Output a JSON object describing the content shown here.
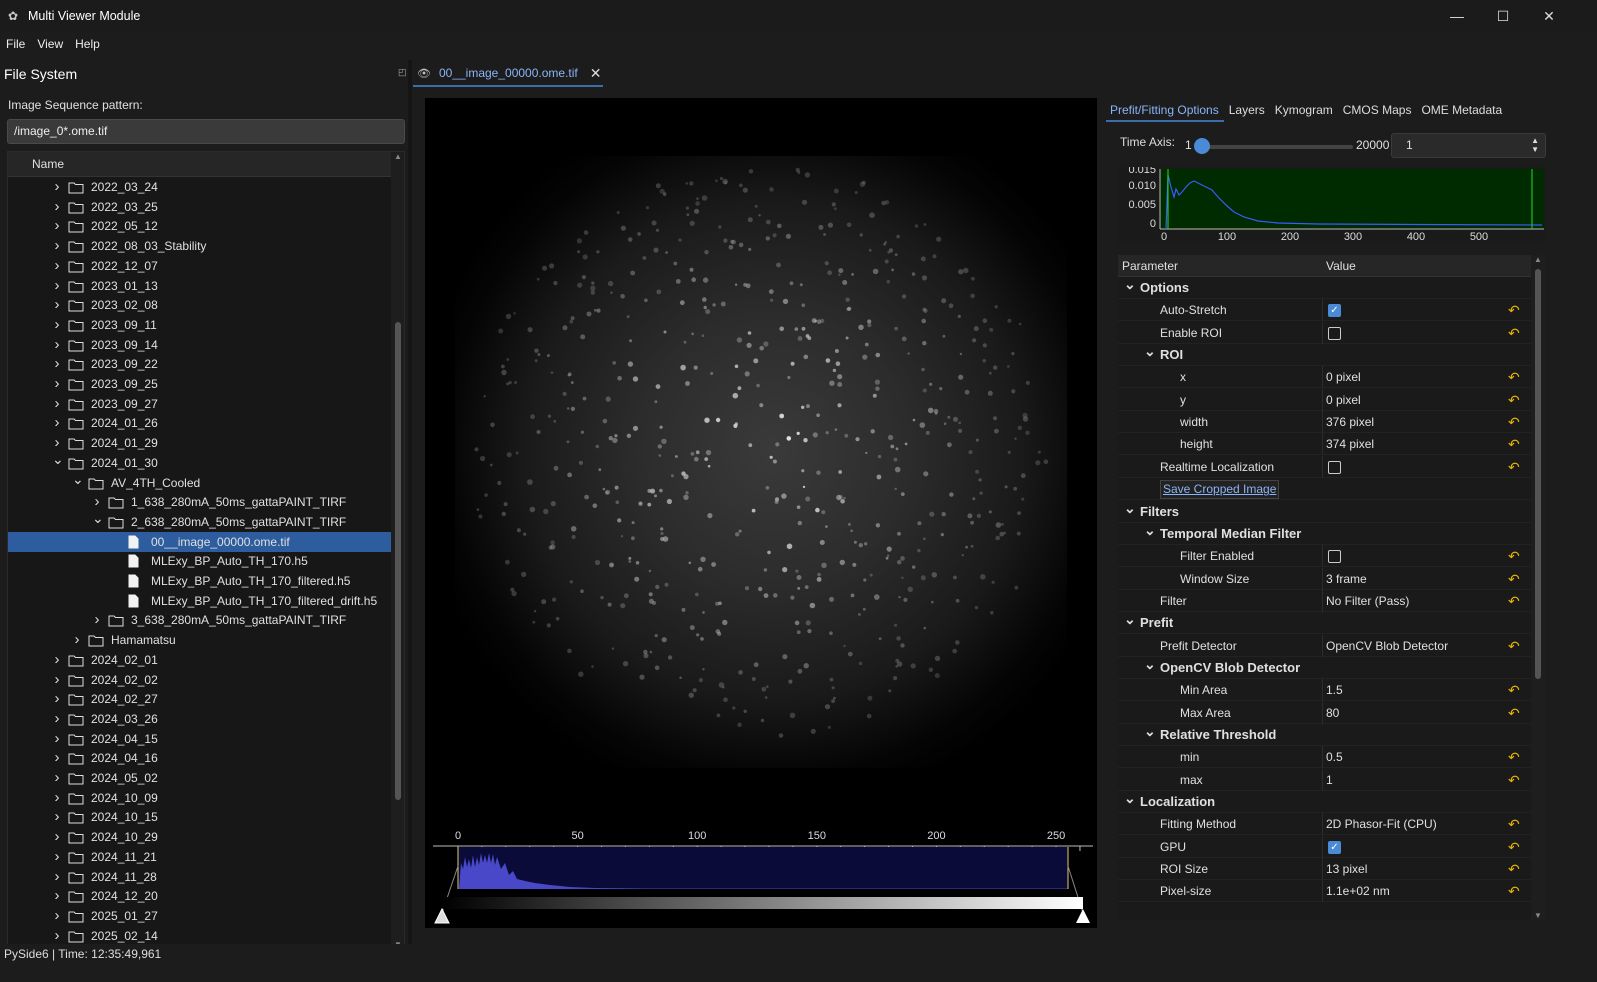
{
  "window": {
    "title": "Multi Viewer Module",
    "icons": [
      "app-icon",
      "minimize-icon",
      "maximize-icon",
      "close-icon"
    ]
  },
  "menu": [
    "File",
    "View",
    "Help"
  ],
  "filesystem": {
    "title": "File System",
    "pattern_label": "Image Sequence pattern:",
    "pattern_value": "/image_0*.ome.tif",
    "column": "Name",
    "rows": [
      {
        "label": "2022_03_24",
        "depth": 2,
        "type": "folder",
        "state": "collapsed"
      },
      {
        "label": "2022_03_25",
        "depth": 2,
        "type": "folder",
        "state": "collapsed"
      },
      {
        "label": "2022_05_12",
        "depth": 2,
        "type": "folder",
        "state": "collapsed"
      },
      {
        "label": "2022_08_03_Stability",
        "depth": 2,
        "type": "folder",
        "state": "collapsed"
      },
      {
        "label": "2022_12_07",
        "depth": 2,
        "type": "folder",
        "state": "collapsed"
      },
      {
        "label": "2023_01_13",
        "depth": 2,
        "type": "folder",
        "state": "collapsed"
      },
      {
        "label": "2023_02_08",
        "depth": 2,
        "type": "folder",
        "state": "collapsed"
      },
      {
        "label": "2023_09_11",
        "depth": 2,
        "type": "folder",
        "state": "collapsed"
      },
      {
        "label": "2023_09_14",
        "depth": 2,
        "type": "folder",
        "state": "collapsed"
      },
      {
        "label": "2023_09_22",
        "depth": 2,
        "type": "folder",
        "state": "collapsed"
      },
      {
        "label": "2023_09_25",
        "depth": 2,
        "type": "folder",
        "state": "collapsed"
      },
      {
        "label": "2023_09_27",
        "depth": 2,
        "type": "folder",
        "state": "collapsed"
      },
      {
        "label": "2024_01_26",
        "depth": 2,
        "type": "folder",
        "state": "collapsed"
      },
      {
        "label": "2024_01_29",
        "depth": 2,
        "type": "folder",
        "state": "collapsed"
      },
      {
        "label": "2024_01_30",
        "depth": 2,
        "type": "folder",
        "state": "expanded"
      },
      {
        "label": "AV_4TH_Cooled",
        "depth": 3,
        "type": "folder",
        "state": "expanded"
      },
      {
        "label": "1_638_280mA_50ms_gattaPAINT_TIRF",
        "depth": 4,
        "type": "folder",
        "state": "collapsed"
      },
      {
        "label": "2_638_280mA_50ms_gattaPAINT_TIRF",
        "depth": 4,
        "type": "folder",
        "state": "expanded"
      },
      {
        "label": "00__image_00000.ome.tif",
        "depth": 5,
        "type": "file",
        "state": "selected"
      },
      {
        "label": "MLExy_BP_Auto_TH_170.h5",
        "depth": 5,
        "type": "file",
        "state": ""
      },
      {
        "label": "MLExy_BP_Auto_TH_170_filtered.h5",
        "depth": 5,
        "type": "file",
        "state": ""
      },
      {
        "label": "MLExy_BP_Auto_TH_170_filtered_drift.h5",
        "depth": 5,
        "type": "file",
        "state": ""
      },
      {
        "label": "3_638_280mA_50ms_gattaPAINT_TIRF",
        "depth": 4,
        "type": "folder",
        "state": "collapsed"
      },
      {
        "label": "Hamamatsu",
        "depth": 3,
        "type": "folder",
        "state": "collapsed"
      },
      {
        "label": "2024_02_01",
        "depth": 2,
        "type": "folder",
        "state": "collapsed"
      },
      {
        "label": "2024_02_02",
        "depth": 2,
        "type": "folder",
        "state": "collapsed"
      },
      {
        "label": "2024_02_27",
        "depth": 2,
        "type": "folder",
        "state": "collapsed"
      },
      {
        "label": "2024_03_26",
        "depth": 2,
        "type": "folder",
        "state": "collapsed"
      },
      {
        "label": "2024_04_15",
        "depth": 2,
        "type": "folder",
        "state": "collapsed"
      },
      {
        "label": "2024_04_16",
        "depth": 2,
        "type": "folder",
        "state": "collapsed"
      },
      {
        "label": "2024_05_02",
        "depth": 2,
        "type": "folder",
        "state": "collapsed"
      },
      {
        "label": "2024_10_09",
        "depth": 2,
        "type": "folder",
        "state": "collapsed"
      },
      {
        "label": "2024_10_15",
        "depth": 2,
        "type": "folder",
        "state": "collapsed"
      },
      {
        "label": "2024_10_29",
        "depth": 2,
        "type": "folder",
        "state": "collapsed"
      },
      {
        "label": "2024_11_21",
        "depth": 2,
        "type": "folder",
        "state": "collapsed"
      },
      {
        "label": "2024_11_28",
        "depth": 2,
        "type": "folder",
        "state": "collapsed"
      },
      {
        "label": "2024_12_20",
        "depth": 2,
        "type": "folder",
        "state": "collapsed"
      },
      {
        "label": "2025_01_27",
        "depth": 2,
        "type": "folder",
        "state": "collapsed"
      },
      {
        "label": "2025_02_14",
        "depth": 2,
        "type": "folder",
        "state": "collapsed"
      }
    ]
  },
  "tab": {
    "label": "00__image_00000.ome.tif"
  },
  "histogram": {
    "ticks": [
      "0",
      "50",
      "100",
      "150",
      "200",
      "250"
    ]
  },
  "right_tabs": [
    "Prefit/Fitting Options",
    "Layers",
    "Kymogram",
    "CMOS Maps",
    "OME Metadata"
  ],
  "time_axis": {
    "label": "Time Axis:",
    "min": "1",
    "max": "20000",
    "value": "1"
  },
  "mini_chart": {
    "yticks": [
      "0.015",
      "0.010",
      "0.005",
      "0"
    ],
    "xticks": [
      "0",
      "100",
      "200",
      "300",
      "400",
      "500"
    ]
  },
  "params": {
    "col_param": "Parameter",
    "col_value": "Value",
    "rows": [
      {
        "name": "Options",
        "level": 0,
        "kind": "group"
      },
      {
        "name": "Auto-Stretch",
        "level": 1,
        "kind": "check",
        "checked": true,
        "reset": true
      },
      {
        "name": "Enable ROI",
        "level": 1,
        "kind": "check",
        "checked": false,
        "reset": true
      },
      {
        "name": "ROI",
        "level": 1,
        "kind": "group"
      },
      {
        "name": "x",
        "level": 2,
        "kind": "value",
        "value": "0 pixel",
        "reset": true
      },
      {
        "name": "y",
        "level": 2,
        "kind": "value",
        "value": "0 pixel",
        "reset": true
      },
      {
        "name": "width",
        "level": 2,
        "kind": "value",
        "value": "376 pixel",
        "reset": true
      },
      {
        "name": "height",
        "level": 2,
        "kind": "value",
        "value": "374 pixel",
        "reset": true
      },
      {
        "name": "Realtime Localization",
        "level": 1,
        "kind": "check",
        "checked": false,
        "reset": true
      },
      {
        "name": "Save Cropped Image",
        "level": 1,
        "kind": "button"
      },
      {
        "name": "Filters",
        "level": 0,
        "kind": "group"
      },
      {
        "name": "Temporal Median Filter",
        "level": 1,
        "kind": "group"
      },
      {
        "name": "Filter Enabled",
        "level": 2,
        "kind": "check",
        "checked": false,
        "reset": true
      },
      {
        "name": "Window Size",
        "level": 2,
        "kind": "value",
        "value": "3 frame",
        "reset": true
      },
      {
        "name": "Filter",
        "level": 1,
        "kind": "value",
        "value": "No Filter (Pass)",
        "reset": true
      },
      {
        "name": "Prefit",
        "level": 0,
        "kind": "group"
      },
      {
        "name": "Prefit Detector",
        "level": 1,
        "kind": "value",
        "value": "OpenCV Blob Detector",
        "reset": true
      },
      {
        "name": "OpenCV Blob Detector",
        "level": 1,
        "kind": "group"
      },
      {
        "name": "Min Area",
        "level": 2,
        "kind": "value",
        "value": "1.5",
        "reset": true
      },
      {
        "name": "Max Area",
        "level": 2,
        "kind": "value",
        "value": "80",
        "reset": true
      },
      {
        "name": "Relative Threshold",
        "level": 1,
        "kind": "group"
      },
      {
        "name": "min",
        "level": 2,
        "kind": "value",
        "value": "0.5",
        "reset": true
      },
      {
        "name": "max",
        "level": 2,
        "kind": "value",
        "value": "1",
        "reset": true
      },
      {
        "name": "Localization",
        "level": 0,
        "kind": "group"
      },
      {
        "name": "Fitting Method",
        "level": 1,
        "kind": "value",
        "value": "2D Phasor-Fit (CPU)",
        "reset": true
      },
      {
        "name": "GPU",
        "level": 1,
        "kind": "check",
        "checked": true,
        "reset": true
      },
      {
        "name": "ROI Size",
        "level": 1,
        "kind": "value",
        "value": "13 pixel",
        "reset": true
      },
      {
        "name": "Pixel-size",
        "level": 1,
        "kind": "value",
        "value": "1.1e+02 nm",
        "reset": true
      }
    ]
  },
  "status": "PySide6 | Time: 12:35:49,961",
  "colors": {
    "accent": "#3b6ea8",
    "link": "#8ab4f8",
    "reset": "#e8b400",
    "hist_fill": "#4848c8"
  }
}
